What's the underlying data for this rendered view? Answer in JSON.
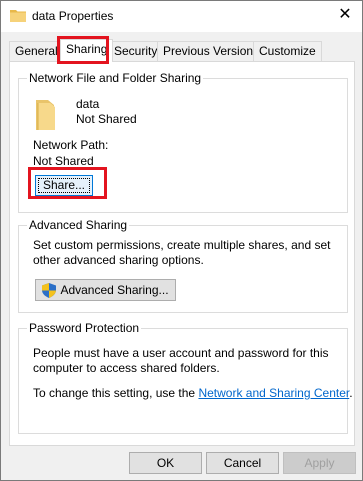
{
  "window": {
    "title": "data Properties",
    "close_glyph": "✕"
  },
  "tabs": [
    {
      "label": "General"
    },
    {
      "label": "Sharing"
    },
    {
      "label": "Security"
    },
    {
      "label": "Previous Versions"
    },
    {
      "label": "Customize"
    }
  ],
  "network_sharing": {
    "title": "Network File and Folder Sharing",
    "folder_name": "data",
    "folder_status": "Not Shared",
    "network_path_label": "Network Path:",
    "network_path_value": "Not Shared",
    "share_button": "Share..."
  },
  "advanced_sharing": {
    "title": "Advanced Sharing",
    "description": "Set custom permissions, create multiple shares, and set other advanced sharing options.",
    "button": "Advanced Sharing..."
  },
  "password_protection": {
    "title": "Password Protection",
    "description": "People must have a user account and password for this computer to access shared folders.",
    "change_prefix": "To change this setting, use the ",
    "link_text": "Network and Sharing Center",
    "change_suffix": "."
  },
  "footer": {
    "ok": "OK",
    "cancel": "Cancel",
    "apply": "Apply"
  },
  "icons": {
    "folder": "folder-icon",
    "shield": "uac-shield-icon",
    "close": "close-icon"
  },
  "colors": {
    "highlight": "#e3141f",
    "link": "#0066cc",
    "focus": "#0078d7"
  }
}
